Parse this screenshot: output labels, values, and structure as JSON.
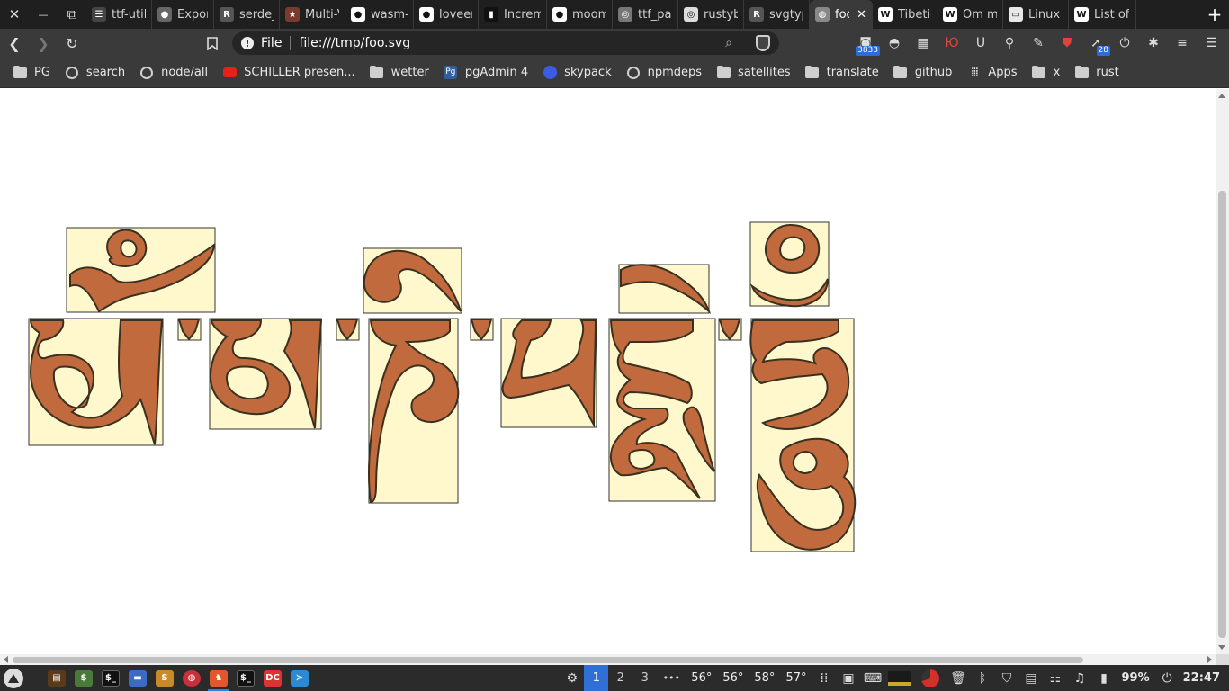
{
  "window": {
    "close_label": "✕",
    "minimize_label": "—",
    "restore_label": "⧉"
  },
  "tabs": [
    {
      "title": "ttf-utils",
      "icon": "ttf-icon",
      "fav_color": "#444",
      "fav_text": "☰"
    },
    {
      "title": "Export",
      "icon": "dot-icon",
      "fav_color": "#666",
      "fav_text": "●"
    },
    {
      "title": "serde_",
      "icon": "rust-icon",
      "fav_color": "#555",
      "fav_text": "R"
    },
    {
      "title": "Multi-V",
      "icon": "star-icon",
      "fav_color": "#7a3b2e",
      "fav_text": "★"
    },
    {
      "title": "wasm-",
      "icon": "github-icon",
      "fav_color": "#fff",
      "fav_text": "●"
    },
    {
      "title": "loveenc",
      "icon": "github-icon",
      "fav_color": "#fff",
      "fav_text": "●"
    },
    {
      "title": "Increm",
      "icon": "film-icon",
      "fav_color": "#111",
      "fav_text": "▮"
    },
    {
      "title": "mooma",
      "icon": "github-icon",
      "fav_color": "#fff",
      "fav_text": "●"
    },
    {
      "title": "ttf_par",
      "icon": "crate-icon",
      "fav_color": "#777",
      "fav_text": "◎"
    },
    {
      "title": "rustybu",
      "icon": "crate-icon",
      "fav_color": "#ddd",
      "fav_text": "◎"
    },
    {
      "title": "svgtyp",
      "icon": "rust-icon",
      "fav_color": "#555",
      "fav_text": "R"
    },
    {
      "title": "foo",
      "icon": "globe-icon",
      "fav_color": "#888",
      "fav_text": "◍",
      "active": true
    },
    {
      "title": "Tibetic",
      "icon": "wikipedia-icon",
      "fav_color": "#fff",
      "fav_text": "W"
    },
    {
      "title": "Om ma",
      "icon": "wikipedia-icon",
      "fav_color": "#fff",
      "fav_text": "W"
    },
    {
      "title": "Linux C",
      "icon": "page-icon",
      "fav_color": "#e8e8e8",
      "fav_text": "▭"
    },
    {
      "title": "List of",
      "icon": "wikipedia-icon",
      "fav_color": "#fff",
      "fav_text": "W"
    }
  ],
  "toolbar": {
    "back": "❮",
    "forward": "❯",
    "reload": "↻",
    "bookmark": "⎙",
    "scheme": "File",
    "url": "file:///tmp/foo.svg",
    "info": "!",
    "zoom_icon": "⌕",
    "extensions": [
      {
        "name": "rss-extension-icon",
        "glyph": "◙",
        "badge": "3833"
      },
      {
        "name": "glasses-extension-icon",
        "glyph": "◓",
        "badge": ""
      },
      {
        "name": "box-extension-icon",
        "glyph": "▦",
        "badge": ""
      },
      {
        "name": "cyrillic-extension-icon",
        "glyph": "Ю",
        "badge": ""
      },
      {
        "name": "u-extension-icon",
        "glyph": "U",
        "badge": ""
      },
      {
        "name": "magnifier-extension-icon",
        "glyph": "⚲",
        "badge": ""
      },
      {
        "name": "pen-extension-icon",
        "glyph": "✎",
        "badge": ""
      },
      {
        "name": "ublock-extension-icon",
        "glyph": "⛊",
        "badge": ""
      },
      {
        "name": "pointer-extension-icon",
        "glyph": "➚",
        "badge": "28"
      },
      {
        "name": "power-extension-icon",
        "glyph": "⏻",
        "badge": ""
      },
      {
        "name": "puzzle-extension-icon",
        "glyph": "✱",
        "badge": ""
      },
      {
        "name": "reading-list-icon",
        "glyph": "≡",
        "badge": ""
      },
      {
        "name": "menu-icon",
        "glyph": "☰",
        "badge": ""
      }
    ]
  },
  "bookmarks": [
    {
      "label": "PG",
      "kind": "folder"
    },
    {
      "label": "search",
      "kind": "globe"
    },
    {
      "label": "node/all",
      "kind": "globe"
    },
    {
      "label": "SCHILLER presen...",
      "kind": "youtube"
    },
    {
      "label": "wetter",
      "kind": "folder"
    },
    {
      "label": "pgAdmin 4",
      "kind": "pgadmin"
    },
    {
      "label": "skypack",
      "kind": "skypack"
    },
    {
      "label": "npmdeps",
      "kind": "globe"
    },
    {
      "label": "satellites",
      "kind": "folder"
    },
    {
      "label": "translate",
      "kind": "folder"
    },
    {
      "label": "github",
      "kind": "folder"
    },
    {
      "label": "Apps",
      "kind": "apps"
    },
    {
      "label": "x",
      "kind": "folder"
    },
    {
      "label": "rust",
      "kind": "folder"
    }
  ],
  "svg_doc": {
    "glyph_fill": "#c06a3e",
    "glyph_stroke": "#3a3020",
    "box_fill": "#fff8cc",
    "box_stroke": "#333333"
  },
  "taskbar": {
    "workspaces": [
      "1",
      "2",
      "3"
    ],
    "current_workspace": "1",
    "temps": [
      "56°",
      "56°",
      "58°",
      "57°"
    ],
    "battery": "99%",
    "clock": "22:47",
    "more": "•••"
  }
}
